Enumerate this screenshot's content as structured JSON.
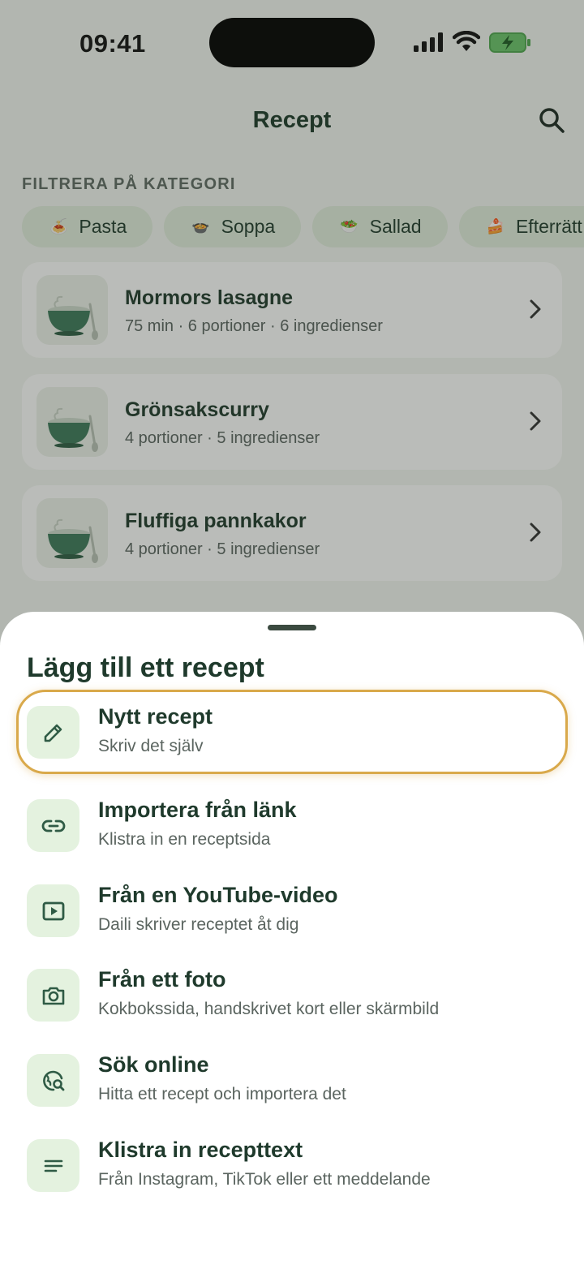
{
  "status_bar": {
    "time": "09:41"
  },
  "header": {
    "title": "Recept"
  },
  "filter": {
    "label": "FILTRERA PÅ KATEGORI",
    "chips": [
      {
        "emoji": "🍝",
        "label": "Pasta"
      },
      {
        "emoji": "🍲",
        "label": "Soppa"
      },
      {
        "emoji": "🥗",
        "label": "Sallad"
      },
      {
        "emoji": "🍰",
        "label": "Efterrätt"
      }
    ]
  },
  "recipes": [
    {
      "name": "Mormors lasagne",
      "meta": "75 min · 6 portioner · 6 ingredienser"
    },
    {
      "name": "Grönsakscurry",
      "meta": "4 portioner · 5 ingredienser"
    },
    {
      "name": "Fluffiga pannkakor",
      "meta": "4 portioner · 5 ingredienser"
    }
  ],
  "sheet": {
    "title": "Lägg till ett recept",
    "options": [
      {
        "icon": "pencil-icon",
        "title": "Nytt recept",
        "subtitle": "Skriv det själv"
      },
      {
        "icon": "link-icon",
        "title": "Importera från länk",
        "subtitle": "Klistra in en receptsida"
      },
      {
        "icon": "video-play-icon",
        "title": "Från en YouTube-video",
        "subtitle": "Daili skriver receptet åt dig"
      },
      {
        "icon": "camera-icon",
        "title": "Från ett foto",
        "subtitle": "Kokbokssida, handskrivet kort eller skärmbild"
      },
      {
        "icon": "globe-search-icon",
        "title": "Sök online",
        "subtitle": "Hitta ett recept och importera det"
      },
      {
        "icon": "text-lines-icon",
        "title": "Klistra in recepttext",
        "subtitle": "Från Instagram, TikTok eller ett meddelande"
      }
    ]
  },
  "colors": {
    "accent": "#2f5b45",
    "icon_bg": "#e4f2df",
    "highlight_border": "#d9a94b"
  }
}
